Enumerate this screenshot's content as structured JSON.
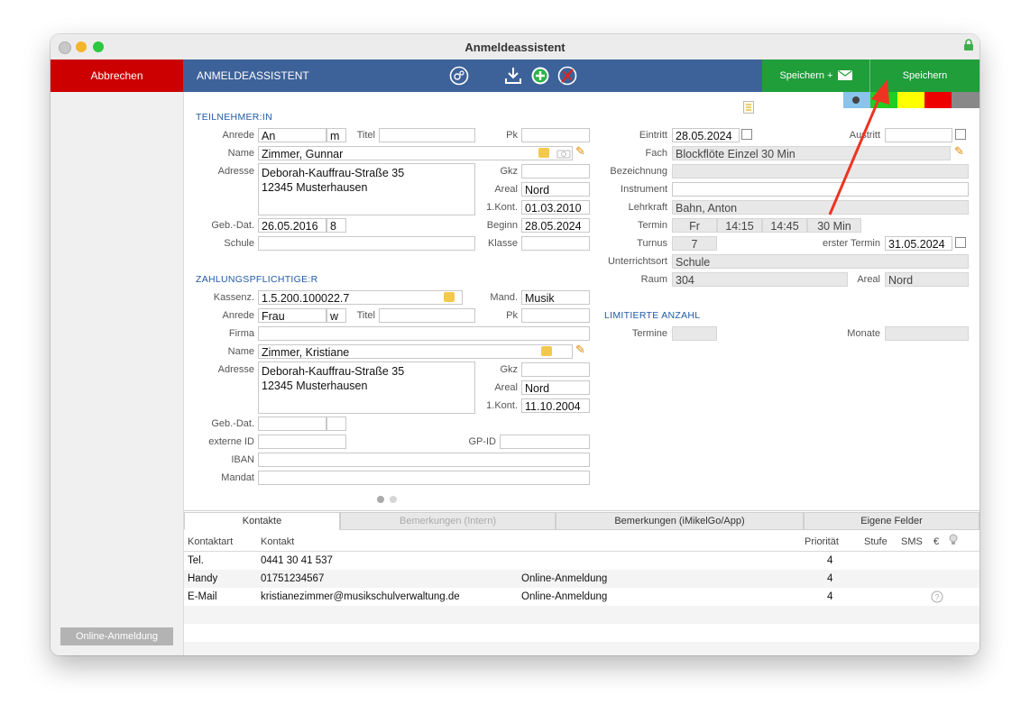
{
  "window": {
    "title": "Anmeldeassistent"
  },
  "toolbar": {
    "cancel": "Abbrechen",
    "label": "ANMELDEASSISTENT",
    "save_mail": "Speichern +",
    "save": "Speichern"
  },
  "sidebar": {
    "online_button": "Online-Anmeldung"
  },
  "colors": {
    "toolbar": "#3d6299",
    "cancel": "#cc0000",
    "save": "#1f9e3a",
    "section": "#1f5aa8",
    "swatches": [
      "#88c4ec",
      "#22cc22",
      "#ffff00",
      "#ee0000",
      "#888888"
    ]
  },
  "student": {
    "section": "TEILNEHMER:IN",
    "anrede_label": "Anrede",
    "anrede": "An",
    "anrede_gender": "m",
    "titel_label": "Titel",
    "titel": "",
    "pk_label": "Pk",
    "pk": "",
    "name_label": "Name",
    "name": "Zimmer, Gunnar",
    "adresse_label": "Adresse",
    "adresse": "Deborah-Kauffrau-Straße 35\n12345 Musterhausen",
    "gkz_label": "Gkz",
    "gkz": "",
    "areal_label": "Areal",
    "areal": "Nord",
    "kont_label": "1.Kont.",
    "kont": "01.03.2010",
    "gebdat_label": "Geb.-Dat.",
    "gebdat": "26.05.2016",
    "age": "8",
    "beginn_label": "Beginn",
    "beginn": "28.05.2024",
    "schule_label": "Schule",
    "schule": "",
    "klasse_label": "Klasse",
    "klasse": ""
  },
  "payer": {
    "section": "ZAHLUNGSPFLICHTIGE:R",
    "kassenz_label": "Kassenz.",
    "kassenz": "1.5.200.100022.7",
    "mand_label": "Mand.",
    "mand": "Musik",
    "anrede_label": "Anrede",
    "anrede": "Frau",
    "anrede_gender": "w",
    "titel_label": "Titel",
    "titel": "",
    "pk_label": "Pk",
    "pk": "",
    "firma_label": "Firma",
    "firma": "",
    "name_label": "Name",
    "name": "Zimmer, Kristiane",
    "adresse_label": "Adresse",
    "adresse": "Deborah-Kauffrau-Straße 35\n12345 Musterhausen",
    "gkz_label": "Gkz",
    "gkz": "",
    "areal_label": "Areal",
    "areal": "Nord",
    "kont_label": "1.Kont.",
    "kont": "11.10.2004",
    "gebdat_label": "Geb.-Dat.",
    "gebdat": "",
    "extid_label": "externe ID",
    "extid": "",
    "gpid_label": "GP-ID",
    "gpid": "",
    "iban_label": "IBAN",
    "iban": "",
    "mandat_label": "Mandat",
    "mandat": ""
  },
  "course": {
    "eintritt_label": "Eintritt",
    "eintritt": "28.05.2024",
    "austritt_label": "Austritt",
    "austritt": "",
    "fach_label": "Fach",
    "fach": "Blockflöte Einzel 30 Min",
    "bezeichnung_label": "Bezeichnung",
    "bezeichnung": "",
    "instrument_label": "Instrument",
    "instrument": "",
    "lehrkraft_label": "Lehrkraft",
    "lehrkraft": "Bahn, Anton",
    "termin_label": "Termin",
    "termin_day": "Fr",
    "termin_from": "14:15",
    "termin_to": "14:45",
    "termin_dur": "30 Min",
    "turnus_label": "Turnus",
    "turnus": "7",
    "erster_label": "erster Termin",
    "erster": "31.05.2024",
    "ort_label": "Unterrichtsort",
    "ort": "Schule",
    "raum_label": "Raum",
    "raum": "304",
    "areal_label": "Areal",
    "areal": "Nord",
    "limit_section": "LIMITIERTE ANZAHL",
    "termine_label": "Termine",
    "termine": "",
    "monate_label": "Monate",
    "monate": ""
  },
  "tabs": [
    "Kontakte",
    "Bemerkungen (Intern)",
    "Bemerkungen (iMikelGo/App)",
    "Eigene Felder"
  ],
  "contacts": {
    "headers": {
      "kontaktart": "Kontaktart",
      "kontakt": "Kontakt",
      "prioritaet": "Priorität",
      "stufe": "Stufe",
      "sms": "SMS",
      "euro": "€"
    },
    "rows": [
      {
        "art": "Tel.",
        "kontakt": "0441 30 41 537",
        "note": "",
        "prio": "4"
      },
      {
        "art": "Handy",
        "kontakt": "01751234567",
        "note": "Online-Anmeldung",
        "prio": "4"
      },
      {
        "art": "E-Mail",
        "kontakt": "kristianezimmer@musikschulverwaltung.de",
        "note": "Online-Anmeldung",
        "prio": "4"
      }
    ]
  }
}
